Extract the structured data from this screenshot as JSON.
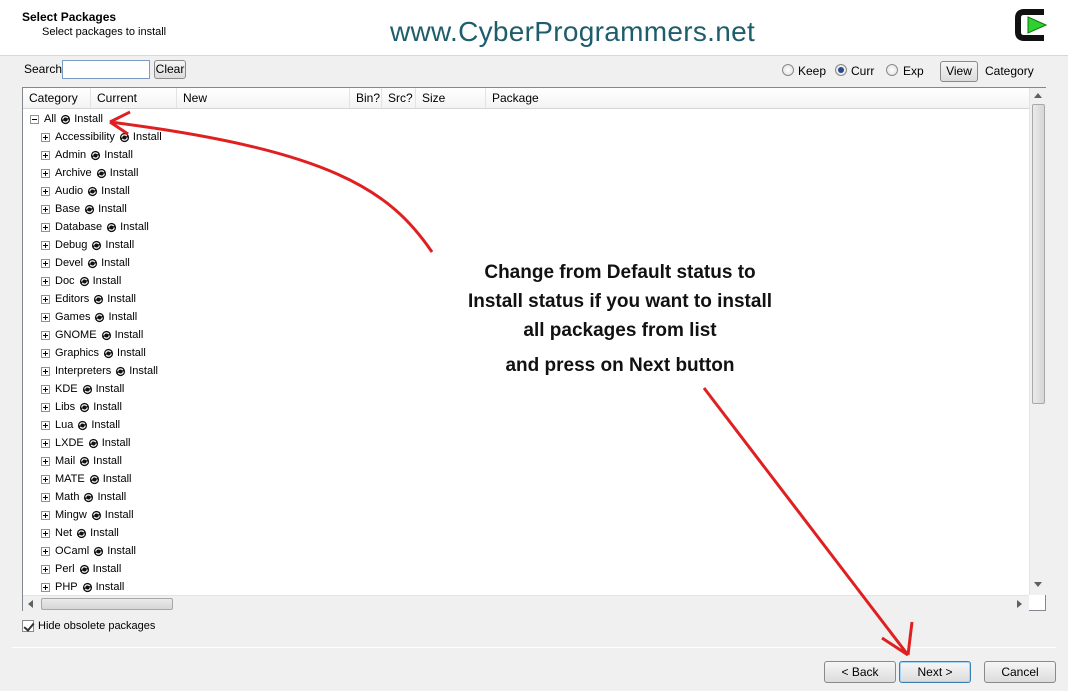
{
  "header": {
    "title": "Select Packages",
    "subtitle": "Select packages to install",
    "watermark": "www.CyberProgrammers.net"
  },
  "search": {
    "label": "Search",
    "value": "",
    "clear_label": "Clear"
  },
  "view_options": {
    "keep": "Keep",
    "curr": "Curr",
    "exp": "Exp",
    "selected": "Curr",
    "view_button": "View",
    "view_mode": "Category"
  },
  "columns": [
    "Category",
    "Current",
    "New",
    "Bin?",
    "Src?",
    "Size",
    "Package"
  ],
  "root": {
    "name": "All",
    "status": "Install"
  },
  "categories": [
    {
      "name": "Accessibility",
      "status": "Install"
    },
    {
      "name": "Admin",
      "status": "Install"
    },
    {
      "name": "Archive",
      "status": "Install"
    },
    {
      "name": "Audio",
      "status": "Install"
    },
    {
      "name": "Base",
      "status": "Install"
    },
    {
      "name": "Database",
      "status": "Install"
    },
    {
      "name": "Debug",
      "status": "Install"
    },
    {
      "name": "Devel",
      "status": "Install"
    },
    {
      "name": "Doc",
      "status": "Install"
    },
    {
      "name": "Editors",
      "status": "Install"
    },
    {
      "name": "Games",
      "status": "Install"
    },
    {
      "name": "GNOME",
      "status": "Install"
    },
    {
      "name": "Graphics",
      "status": "Install"
    },
    {
      "name": "Interpreters",
      "status": "Install"
    },
    {
      "name": "KDE",
      "status": "Install"
    },
    {
      "name": "Libs",
      "status": "Install"
    },
    {
      "name": "Lua",
      "status": "Install"
    },
    {
      "name": "LXDE",
      "status": "Install"
    },
    {
      "name": "Mail",
      "status": "Install"
    },
    {
      "name": "MATE",
      "status": "Install"
    },
    {
      "name": "Math",
      "status": "Install"
    },
    {
      "name": "Mingw",
      "status": "Install"
    },
    {
      "name": "Net",
      "status": "Install"
    },
    {
      "name": "OCaml",
      "status": "Install"
    },
    {
      "name": "Perl",
      "status": "Install"
    },
    {
      "name": "PHP",
      "status": "Install"
    }
  ],
  "hide_obsolete": {
    "label": "Hide obsolete packages",
    "checked": true
  },
  "buttons": {
    "back": "< Back",
    "next": "Next >",
    "cancel": "Cancel"
  },
  "annotation": {
    "lines": [
      "Change from Default status to",
      "Install status if you want to install",
      "all packages from list",
      "and press on Next button"
    ],
    "arrow_color": "#e02020"
  },
  "icons": [
    "cygwin-logo-icon",
    "cycle-status-icon",
    "expand-plus-icon",
    "collapse-minus-icon",
    "check-icon"
  ]
}
